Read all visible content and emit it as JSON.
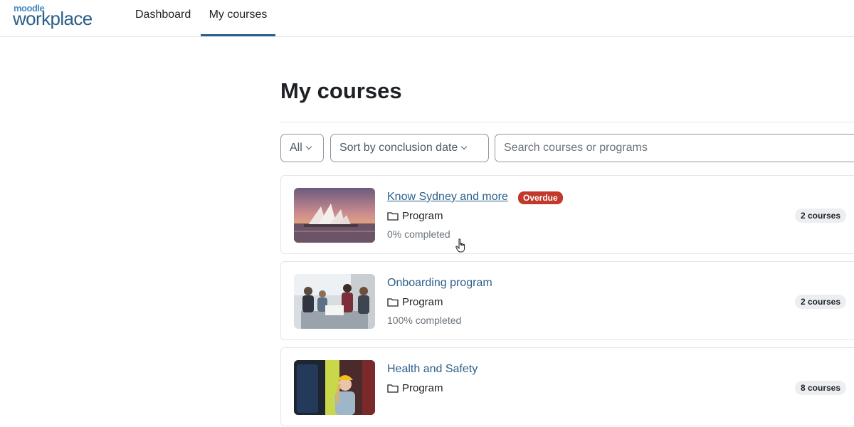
{
  "header": {
    "logo_top": "moodle",
    "logo_main": "workplace",
    "nav": [
      {
        "label": "Dashboard"
      },
      {
        "label": "My courses"
      }
    ]
  },
  "page": {
    "title": "My courses"
  },
  "filters": {
    "all_label": "All",
    "sort_label": "Sort by conclusion date",
    "search_placeholder": "Search courses or programs"
  },
  "courses": [
    {
      "title": "Know Sydney and more",
      "badge": "Overdue",
      "type": "Program",
      "progress": "0% completed",
      "count": "2 courses"
    },
    {
      "title": "Onboarding program",
      "type": "Program",
      "progress": "100% completed",
      "count": "2 courses"
    },
    {
      "title": "Health and Safety",
      "type": "Program",
      "count": "8 courses"
    }
  ],
  "colors": {
    "brand": "#2b5f8a",
    "overdue": "#c0392b",
    "badge_bg": "#eceef1"
  },
  "icons": [
    "folder-icon",
    "chevron-down-icon",
    "hand-pointer-icon"
  ]
}
